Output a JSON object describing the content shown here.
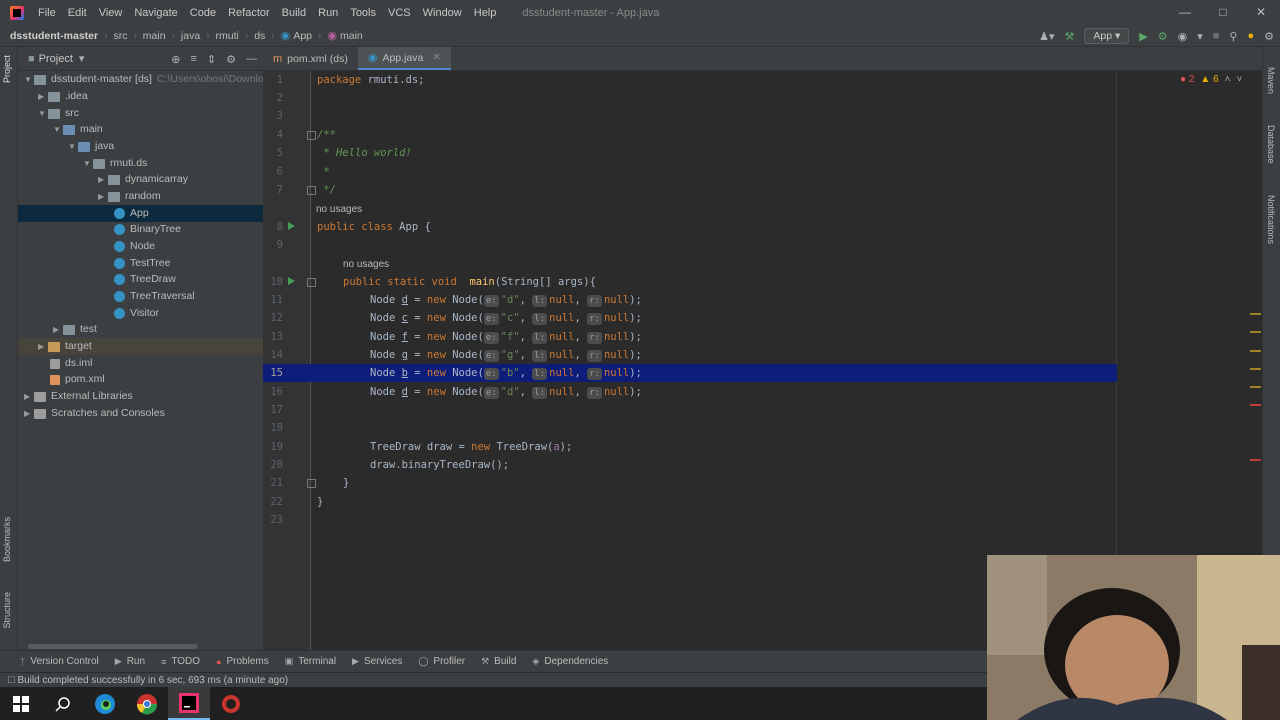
{
  "menu": {
    "items": [
      "File",
      "Edit",
      "View",
      "Navigate",
      "Code",
      "Refactor",
      "Build",
      "Run",
      "Tools",
      "VCS",
      "Window",
      "Help"
    ],
    "window_title": "dsstudent-master - App.java"
  },
  "nav": {
    "crumbs": [
      "dsstudent-master",
      "src",
      "main",
      "java",
      "rmuti",
      "ds",
      "App",
      "main"
    ],
    "run_config": "App"
  },
  "project": {
    "title": "Project",
    "tree": [
      {
        "label": "dsstudent-master [ds]",
        "extra": "C:\\Users\\obosi\\Downlo",
        "kind": "folder"
      },
      {
        "label": ".idea",
        "kind": "folder"
      },
      {
        "label": "src",
        "kind": "folder"
      },
      {
        "label": "main",
        "kind": "folder-src"
      },
      {
        "label": "java",
        "kind": "folder-src"
      },
      {
        "label": "rmuti.ds",
        "kind": "folder"
      },
      {
        "label": "dynamicarray",
        "kind": "folder"
      },
      {
        "label": "random",
        "kind": "folder"
      },
      {
        "label": "App",
        "kind": "class"
      },
      {
        "label": "BinaryTree",
        "kind": "class"
      },
      {
        "label": "Node",
        "kind": "class"
      },
      {
        "label": "TestTree",
        "kind": "class"
      },
      {
        "label": "TreeDraw",
        "kind": "class"
      },
      {
        "label": "TreeTraversal",
        "kind": "class"
      },
      {
        "label": "Visitor",
        "kind": "class"
      },
      {
        "label": "test",
        "kind": "folder"
      },
      {
        "label": "target",
        "kind": "folder-target"
      },
      {
        "label": "ds.iml",
        "kind": "file"
      },
      {
        "label": "pom.xml",
        "kind": "xml"
      },
      {
        "label": "External Libraries",
        "kind": "lib"
      },
      {
        "label": "Scratches and Consoles",
        "kind": "lib"
      }
    ]
  },
  "tabs": [
    {
      "label": "pom.xml (ds)",
      "active": false
    },
    {
      "label": "App.java",
      "active": true
    }
  ],
  "editor": {
    "line_numbers": [
      "1",
      "2",
      "3",
      "4",
      "5",
      "6",
      "7",
      "8",
      "9",
      "10",
      "11",
      "12",
      "13",
      "14",
      "15",
      "16",
      "17",
      "18",
      "19",
      "20",
      "21",
      "22",
      "23"
    ],
    "current_line": "15",
    "usages_1": "no usages",
    "usages_2": "no usages",
    "code": {
      "l1_kw": "package",
      "l1_rest": " rmuti.ds;",
      "l4": "/**",
      "l5": " * Hello world!",
      "l6": " *",
      "l7": " */",
      "l8_kw": "public class",
      "l8_rest": " App {",
      "l10_kw": "public static void",
      "l10_fn": "main",
      "l10_rest": "(String[] args){",
      "nodes": [
        {
          "var": "d",
          "val": "\"d\""
        },
        {
          "var": "c",
          "val": "\"c\""
        },
        {
          "var": "f",
          "val": "\"f\""
        },
        {
          "var": "g",
          "val": "\"g\""
        },
        {
          "var": "b",
          "val": "\"b\""
        },
        {
          "var": "d",
          "val": "\"d\""
        }
      ],
      "node_type": "Node",
      "new_kw": "new",
      "null_kw": "null",
      "hint_e": "e:",
      "hint_l": "l:",
      "hint_r": "r:",
      "l19_a": "TreeDraw draw = ",
      "l19_kw": "new",
      "l19_b": " TreeDraw(",
      "l19_arg": "a",
      "l19_c": ");",
      "l20": "draw.binaryTreeDraw();",
      "l21": "}",
      "l22": "}"
    },
    "errors": "2",
    "warnings": "6"
  },
  "bottom_tools": [
    "Version Control",
    "Run",
    "TODO",
    "Problems",
    "Terminal",
    "Services",
    "Profiler",
    "Build",
    "Dependencies"
  ],
  "status": "Build completed successfully in 6 sec, 693 ms (a minute ago)",
  "left_stripe": [
    "Project",
    "Bookmarks",
    "Structure"
  ],
  "right_stripe": [
    "Maven",
    "Database",
    "Notifications"
  ]
}
